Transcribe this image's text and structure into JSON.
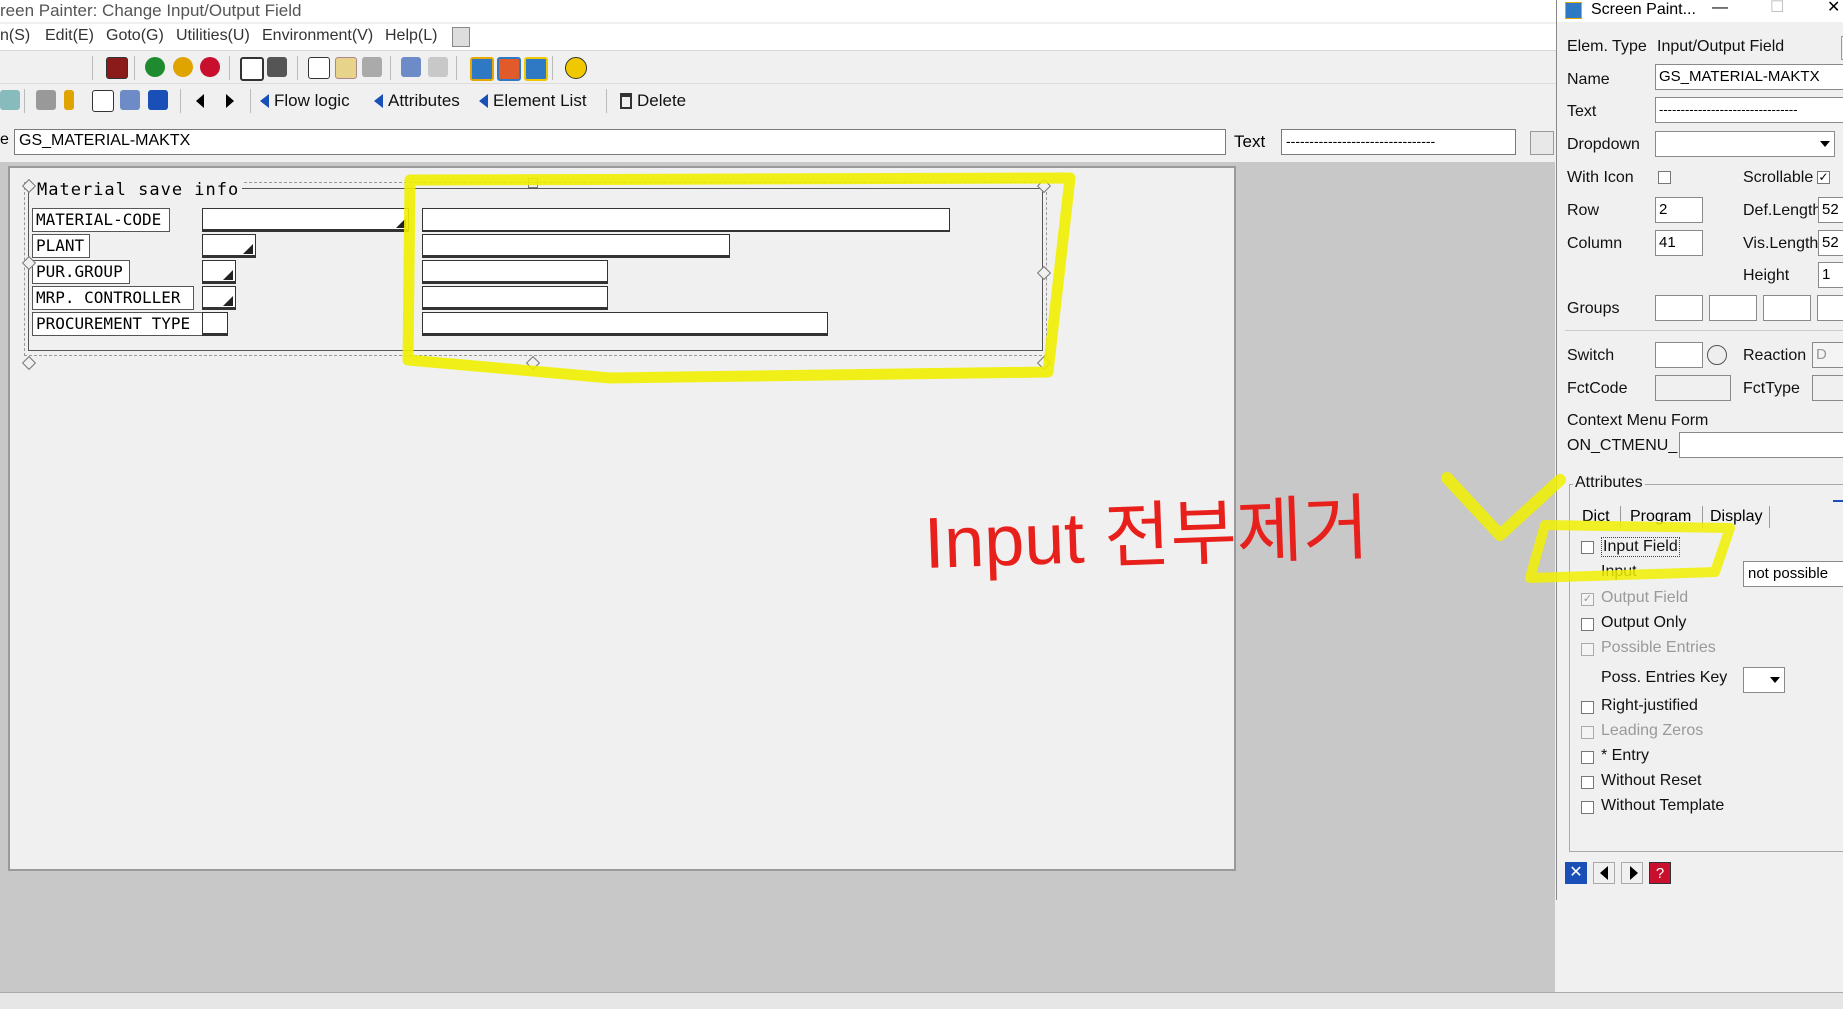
{
  "window": {
    "title": "reen Painter:  Change Input/Output Field"
  },
  "menu": [
    "n(S)",
    "Edit(E)",
    "Goto(G)",
    "Utilities(U)",
    "Environment(V)",
    "Help(L)"
  ],
  "toolbar2": {
    "flow_logic": "Flow logic",
    "attributes": "Attributes",
    "element_list": "Element List",
    "delete": "Delete"
  },
  "name_row": {
    "name_label": "e",
    "name_value": "GS_MATERIAL-MAKTX",
    "text_label": "Text",
    "text_value": "--------------------------------"
  },
  "design": {
    "frame_title": "Material save info",
    "labels": [
      "MATERIAL-CODE",
      "PLANT",
      "PUR.GROUP",
      "MRP. CONTROLLER",
      "PROCUREMENT TYPE"
    ]
  },
  "annotation": {
    "handwritten_note": "Input 전부제거"
  },
  "panel": {
    "title": "Screen Paint...",
    "elem_type_label": "Elem. Type",
    "elem_type_value": "Input/Output Field",
    "name_label": "Name",
    "name_value": "GS_MATERIAL-MAKTX",
    "text_label": "Text",
    "text_value": "--------------------------------",
    "dropdown_label": "Dropdown",
    "with_icon_label": "With Icon",
    "scrollable_label": "Scrollable",
    "row_label": "Row",
    "row_value": "2",
    "column_label": "Column",
    "column_value": "41",
    "def_length_label": "Def.Length",
    "def_length_value": "52",
    "vis_length_label": "Vis.Length",
    "vis_length_value": "52",
    "height_label": "Height",
    "height_value": "1",
    "groups_label": "Groups",
    "switch_label": "Switch",
    "reaction_label": "Reaction",
    "reaction_value": "D",
    "fctcode_label": "FctCode",
    "fcttype_label": "FctType",
    "context_menu_label": "Context Menu Form",
    "on_ctmenu_label": "ON_CTMENU_",
    "attributes_label": "Attributes",
    "tabs": [
      "Dict",
      "Program",
      "Display"
    ],
    "input_field_label": "Input Field",
    "input_label": "Input",
    "input_select_value": "not possible",
    "output_field_label": "Output Field",
    "output_only_label": "Output Only",
    "possible_entries_label": "Possible Entries",
    "poss_entries_key_label": "Poss. Entries Key",
    "right_justified_label": "Right-justified",
    "leading_zeros_label": "Leading Zeros",
    "entry_label": "* Entry",
    "without_reset_label": "Without Reset",
    "without_template_label": "Without Template"
  },
  "colors": {
    "highlight": "#f0f000",
    "handwriting": "#e8201c",
    "sap_blue": "#1b4fb8"
  }
}
